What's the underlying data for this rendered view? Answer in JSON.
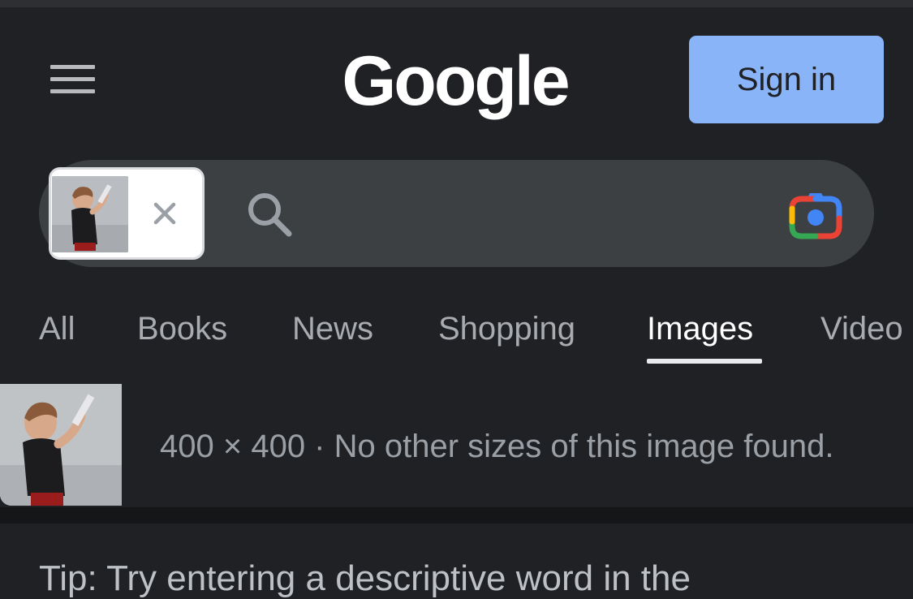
{
  "header": {
    "logo_text": "Google",
    "signin_label": "Sign in"
  },
  "search": {
    "chip_close_glyph": "×",
    "query_value": ""
  },
  "tabs": [
    {
      "label": "All",
      "active": false
    },
    {
      "label": "Books",
      "active": false
    },
    {
      "label": "News",
      "active": false
    },
    {
      "label": "Shopping",
      "active": false
    },
    {
      "label": "Images",
      "active": true
    },
    {
      "label": "Video",
      "active": false
    }
  ],
  "result": {
    "info": "400 × 400 · No other sizes of this image found."
  },
  "tip": {
    "text": "Tip: Try entering a descriptive word in the"
  },
  "colors": {
    "background": "#202124",
    "search_bar": "#3c4043",
    "signin_bg": "#8ab4f8",
    "lens_blue": "#4285f4",
    "lens_red": "#ea4335",
    "lens_yellow": "#fbbc04",
    "lens_green": "#34a853"
  },
  "icons": [
    "menu-icon",
    "close-icon",
    "search-icon",
    "lens-camera-icon"
  ]
}
